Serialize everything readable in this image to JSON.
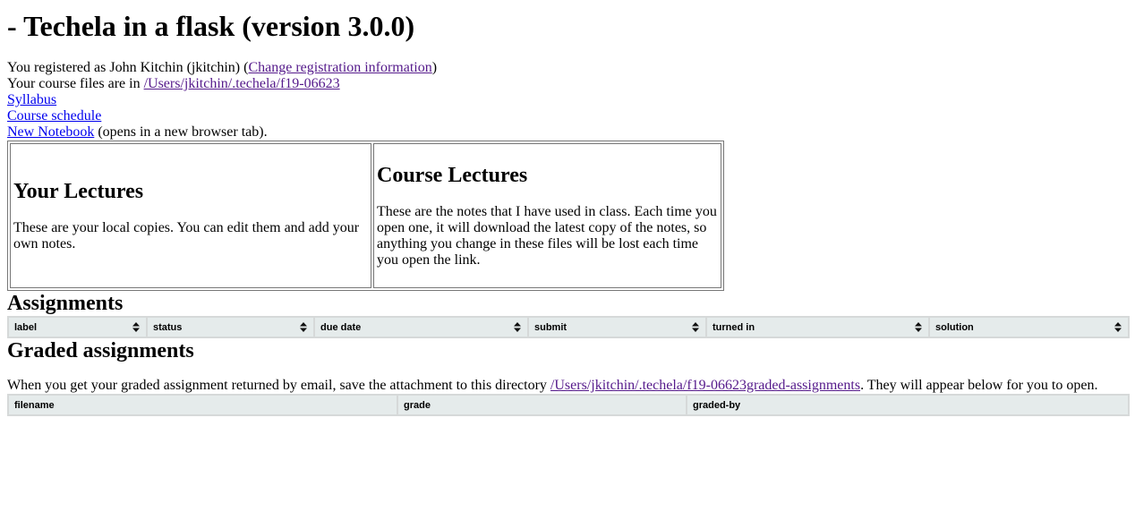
{
  "page": {
    "title": "- Techela in a flask (version 3.0.0)",
    "registration": {
      "prefix": "You registered as John Kitchin (jkitchin) (",
      "link_label": "Change registration information",
      "suffix": ")"
    },
    "course_files": {
      "prefix": "Your course files are in ",
      "path": "/Users/jkitchin/.techela/f19-06623"
    },
    "syllabus_link": "Syllabus",
    "schedule_link": "Course schedule",
    "new_notebook": {
      "link_label": "New Notebook",
      "suffix": " (opens in a new browser tab)."
    }
  },
  "lectures": {
    "your": {
      "heading": "Your Lectures",
      "description": "These are your local copies. You can edit them and add your own notes."
    },
    "course": {
      "heading": "Course Lectures",
      "description": "These are the notes that I have used in class. Each time you open one, it will download the latest copy of the notes, so anything you change in these files will be lost each time you open the link."
    }
  },
  "assignments": {
    "heading": "Assignments",
    "columns": [
      "label",
      "status",
      "due date",
      "submit",
      "turned in",
      "solution"
    ]
  },
  "graded": {
    "heading": "Graded assignments",
    "text_prefix": "When you get your graded assignment returned by email, save the attachment to this directory ",
    "dir_link": "/Users/jkitchin/.techela/f19-06623graded-assignments",
    "text_suffix": ". They will appear below for you to open.",
    "columns": [
      "filename",
      "grade",
      "graded-by"
    ]
  },
  "colors": {
    "link": "#0000ee",
    "visited_link": "#551a8b",
    "table_header_bg": "#e5ebeb",
    "table_border": "#d6d9d9"
  },
  "icons": {
    "sort": "sort-arrows-icon"
  }
}
